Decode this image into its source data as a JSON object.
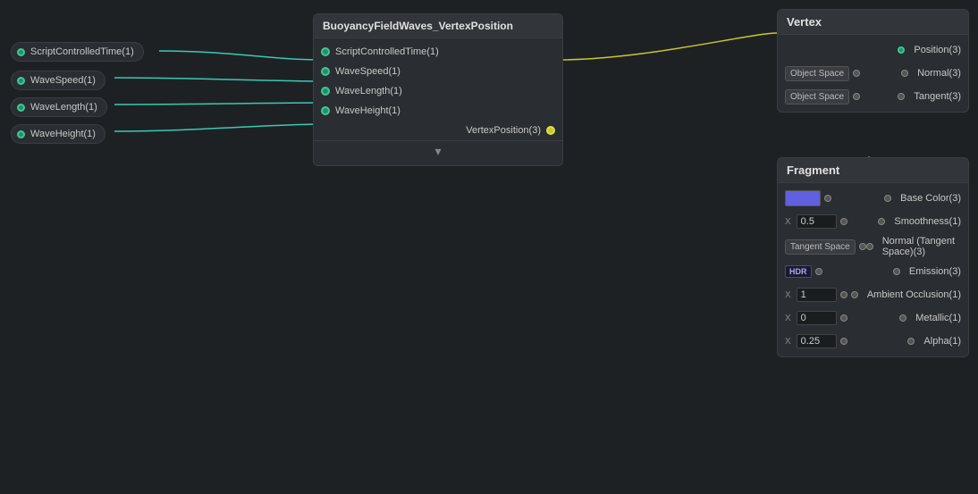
{
  "left_inputs": [
    {
      "label": "ScriptControlledTime(1)",
      "id": "sci"
    },
    {
      "label": "WaveSpeed(1)",
      "id": "ws"
    },
    {
      "label": "WaveLength(1)",
      "id": "wl"
    },
    {
      "label": "WaveHeight(1)",
      "id": "wh"
    }
  ],
  "center_node": {
    "title": "BuoyancyFieldWaves_VertexPosition",
    "inputs": [
      "ScriptControlledTime(1)",
      "WaveSpeed(1)",
      "WaveLength(1)",
      "WaveHeight(1)"
    ],
    "outputs": [
      "VertexPosition(3)"
    ],
    "expand_icon": "▾"
  },
  "vertex_panel": {
    "title": "Vertex",
    "rows": [
      {
        "label": "Position(3)",
        "left": "",
        "connected": true
      },
      {
        "label": "Normal(3)",
        "left": "Object Space",
        "connected": false
      },
      {
        "label": "Tangent(3)",
        "left": "Object Space",
        "connected": false
      }
    ]
  },
  "fragment_panel": {
    "title": "Fragment",
    "rows": [
      {
        "label": "Base Color(3)",
        "left_type": "color",
        "connected": false
      },
      {
        "label": "Smoothness(1)",
        "left_type": "num",
        "num_prefix": "X",
        "num_val": "0.5",
        "connected": false
      },
      {
        "label": "Normal (Tangent Space)(3)",
        "left_type": "tangent",
        "connected": false
      },
      {
        "label": "Emission(3)",
        "left_type": "hdr",
        "connected": false
      },
      {
        "label": "Ambient Occlusion(1)",
        "left_type": "num",
        "num_prefix": "X",
        "num_val": "1",
        "connected": false
      },
      {
        "label": "Metallic(1)",
        "left_type": "num",
        "num_prefix": "X",
        "num_val": "0",
        "connected": false
      },
      {
        "label": "Alpha(1)",
        "left_type": "num",
        "num_prefix": "X",
        "num_val": "0.25",
        "connected": false
      }
    ]
  },
  "wire_color_cyan": "#3ac9b4",
  "wire_color_yellow": "#c8c830"
}
